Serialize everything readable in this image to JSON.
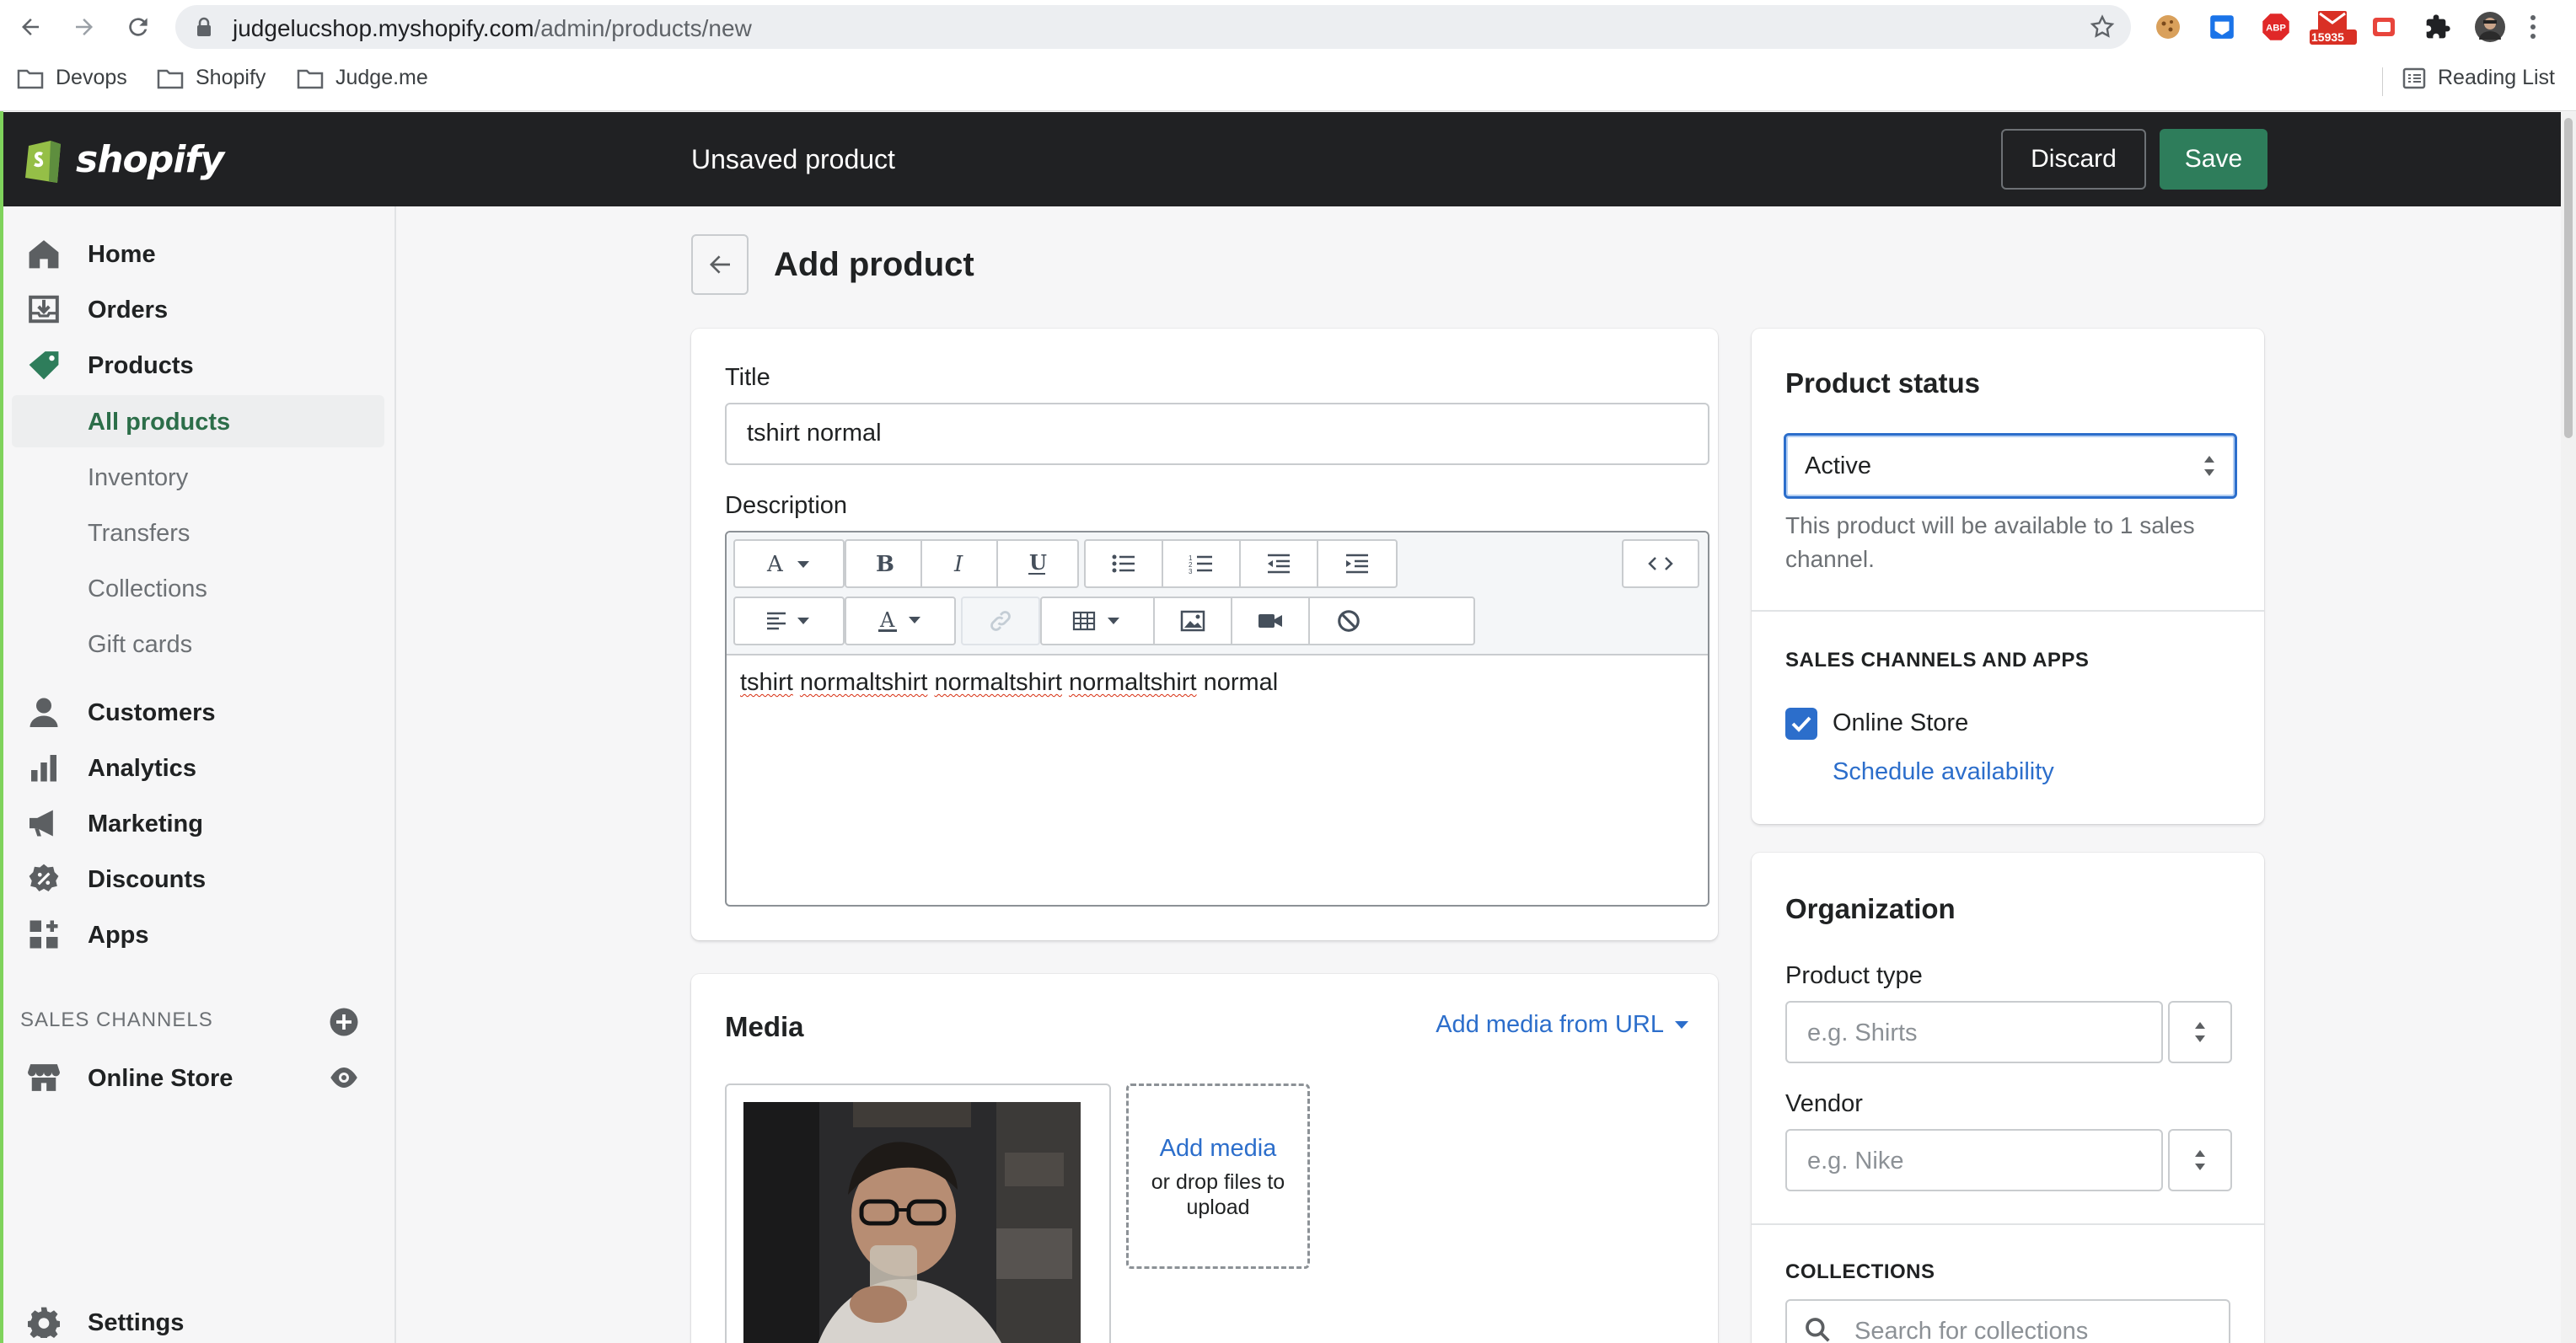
{
  "browser": {
    "url_host": "judgelucshop.myshopify.com",
    "url_path": "/admin/products/new",
    "ext_badge": "15935",
    "bookmarks": [
      "Devops",
      "Shopify",
      "Judge.me"
    ],
    "reading_list": "Reading List"
  },
  "topbar": {
    "logo": "shopify",
    "title": "Unsaved product",
    "discard": "Discard",
    "save": "Save"
  },
  "sidebar": {
    "items": [
      {
        "label": "Home",
        "icon": "home-icon"
      },
      {
        "label": "Orders",
        "icon": "orders-icon"
      },
      {
        "label": "Products",
        "icon": "tag-icon"
      }
    ],
    "product_subitems": [
      "All products",
      "Inventory",
      "Transfers",
      "Collections",
      "Gift cards"
    ],
    "items2": [
      {
        "label": "Customers",
        "icon": "person-icon"
      },
      {
        "label": "Analytics",
        "icon": "bar-chart-icon"
      },
      {
        "label": "Marketing",
        "icon": "megaphone-icon"
      },
      {
        "label": "Discounts",
        "icon": "discount-icon"
      },
      {
        "label": "Apps",
        "icon": "apps-icon"
      }
    ],
    "sales_channels_title": "SALES CHANNELS",
    "online_store": "Online Store",
    "settings": "Settings"
  },
  "main": {
    "page_title": "Add product",
    "title_label": "Title",
    "title_value": "tshirt normal",
    "description_label": "Description",
    "description_text": [
      "tshirt",
      "normaltshirt",
      "normaltshirt",
      "normaltshirt",
      "normal"
    ],
    "media": {
      "heading": "Media",
      "add_from_url": "Add media from URL",
      "add_media": "Add media",
      "drop_hint": "or drop files to upload"
    }
  },
  "status_card": {
    "heading": "Product status",
    "selected": "Active",
    "help": "This product will be available to 1 sales channel.",
    "channels_title": "SALES CHANNELS AND APPS",
    "channel": "Online Store",
    "channel_checked": true,
    "schedule": "Schedule availability"
  },
  "organization": {
    "heading": "Organization",
    "type_label": "Product type",
    "type_placeholder": "e.g. Shirts",
    "vendor_label": "Vendor",
    "vendor_placeholder": "e.g. Nike",
    "collections_title": "COLLECTIONS",
    "collections_placeholder": "Search for collections"
  },
  "colors": {
    "brand_green": "#2e7d5b",
    "link_blue": "#2c6ecb",
    "topbar": "#202123"
  }
}
